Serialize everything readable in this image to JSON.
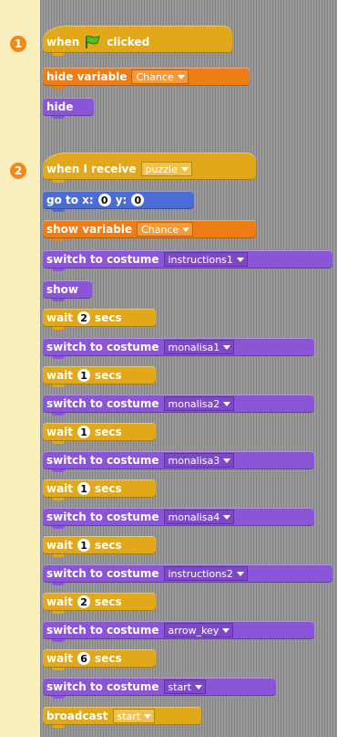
{
  "badges": [
    "1",
    "2"
  ],
  "script1": {
    "when_label": "when",
    "clicked_label": "clicked",
    "hide_variable_label": "hide variable",
    "hide_variable_value": "Chance",
    "hide_label": "hide"
  },
  "script2": {
    "when_receive_label": "when I receive",
    "when_receive_value": "puzzle",
    "goto": {
      "label_x": "go to x:",
      "x": "0",
      "label_y": "y:",
      "y": "0"
    },
    "show_variable_label": "show variable",
    "show_variable_value": "Chance",
    "show_label": "show",
    "broadcast_label": "broadcast",
    "broadcast_value": "start"
  },
  "labels": {
    "switch_to_costume": "switch to costume",
    "wait": "wait",
    "secs": "secs"
  },
  "costumes": [
    "instructions1",
    "monalisa1",
    "monalisa2",
    "monalisa3",
    "monalisa4",
    "instructions2",
    "arrow_key",
    "start"
  ],
  "waits": [
    "2",
    "1",
    "1",
    "1",
    "1",
    "2",
    "6"
  ],
  "colors": {
    "control": "#e1a91a",
    "looks": "#8a55d7",
    "variables": "#ee7d16",
    "motion": "#4a6cd4",
    "background": "#fbefbf",
    "badge": "#f08b18"
  }
}
